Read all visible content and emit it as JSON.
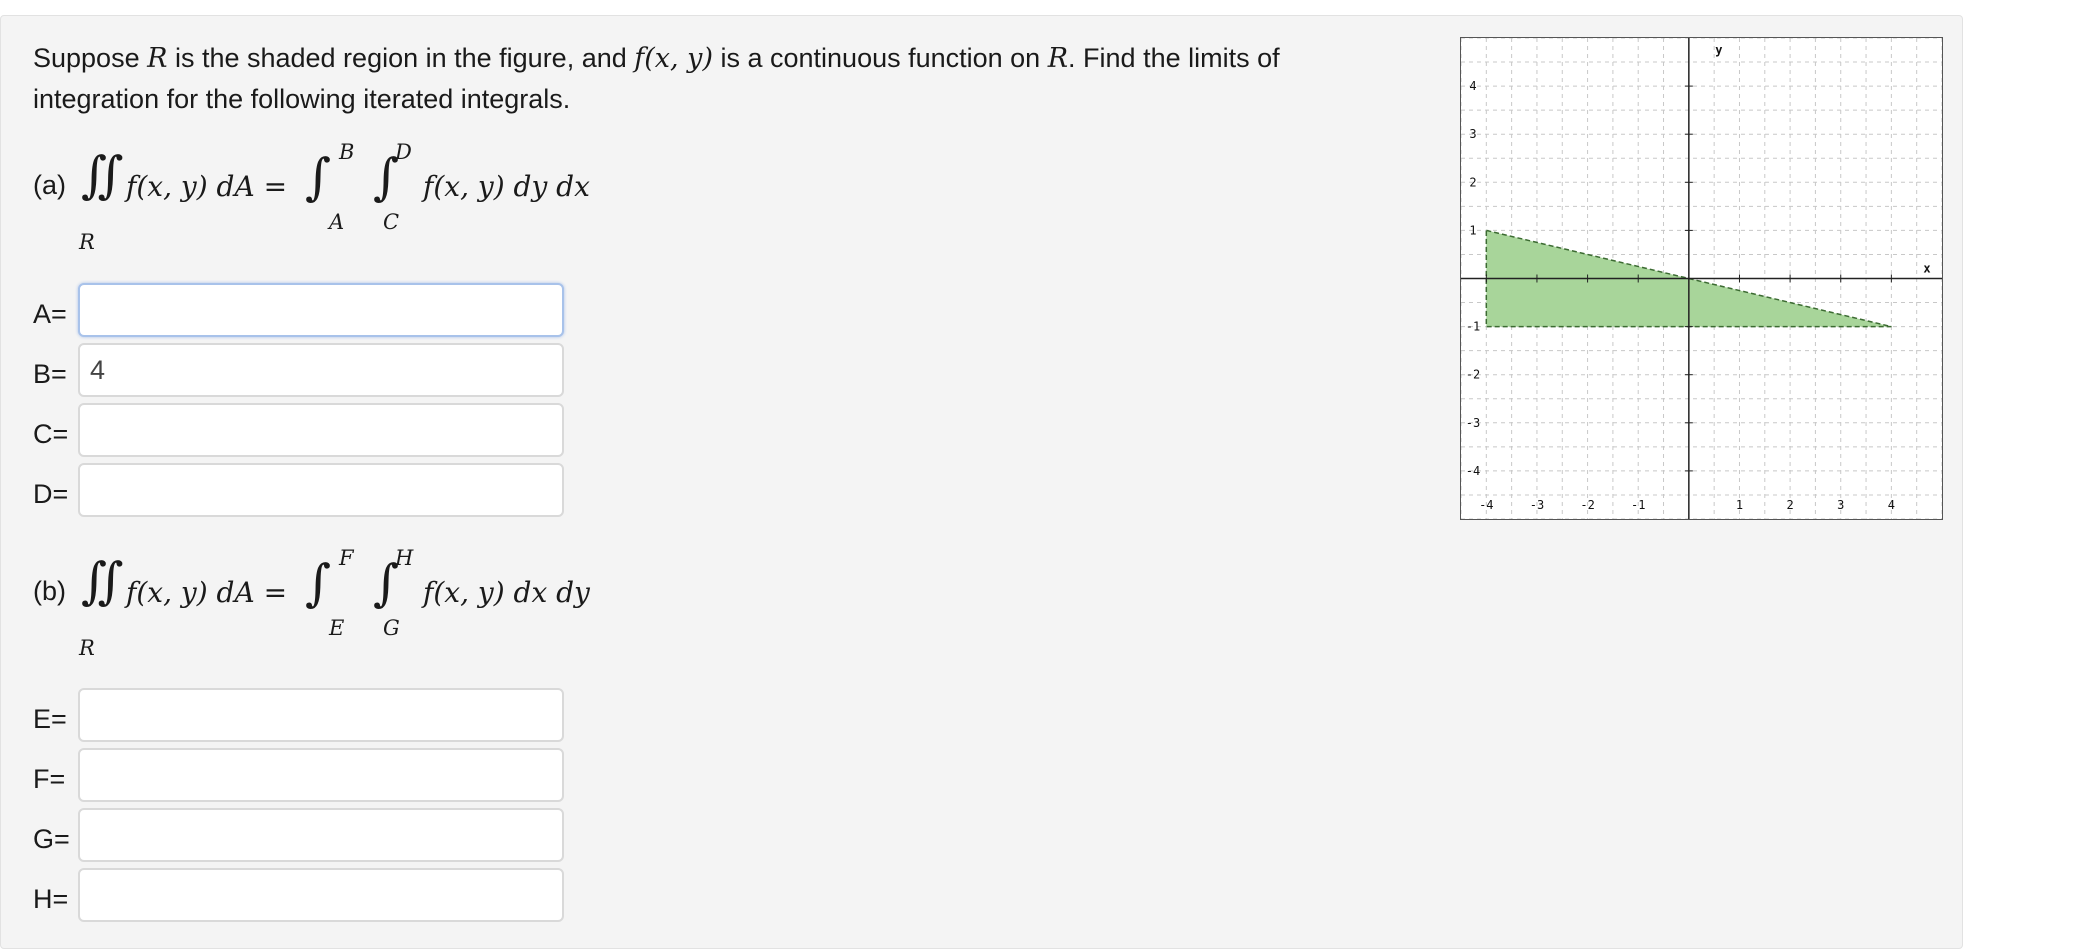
{
  "question": {
    "p1": "Suppose ",
    "R": "R",
    "p2": " is the shaded region in the figure, and ",
    "fxy": "f(x, y)",
    "p3": " is a continuous function on ",
    "R2": "R",
    "p4": ". Find the limits of integration for the following iterated integrals."
  },
  "part_a": {
    "label": "(a)",
    "lhs": "∬",
    "lhs_sub": "R",
    "lhs_expr": "f(x, y) dA =",
    "outer_upper": "B",
    "outer_lower": "A",
    "inner_upper": "D",
    "inner_lower": "C",
    "integrand": "f(x, y) dy dx",
    "int": "∫",
    "fields": [
      {
        "label": "A=",
        "value": ""
      },
      {
        "label": "B=",
        "value": "4"
      },
      {
        "label": "C=",
        "value": ""
      },
      {
        "label": "D=",
        "value": ""
      }
    ]
  },
  "part_b": {
    "label": "(b)",
    "lhs": "∬",
    "lhs_sub": "R",
    "lhs_expr": "f(x, y) dA =",
    "outer_upper": "F",
    "outer_lower": "E",
    "inner_upper": "H",
    "inner_lower": "G",
    "integrand": "f(x, y) dx dy",
    "int": "∫",
    "fields": [
      {
        "label": "E=",
        "value": ""
      },
      {
        "label": "F=",
        "value": ""
      },
      {
        "label": "G=",
        "value": ""
      },
      {
        "label": "H=",
        "value": ""
      }
    ]
  },
  "graph": {
    "x_axis_label": "x",
    "y_axis_label": "y",
    "x_ticks": [
      "-4",
      "-3",
      "-2",
      "-1",
      "1",
      "2",
      "3",
      "4"
    ],
    "y_ticks": [
      "4",
      "3",
      "2",
      "1",
      "-1",
      "-2",
      "-3",
      "-4"
    ],
    "xlim": [
      -4.5,
      5
    ],
    "ylim": [
      -5,
      5
    ],
    "region_vertices": [
      [
        -4,
        1
      ],
      [
        4,
        -1
      ],
      [
        -4,
        -1
      ]
    ],
    "fill_color": "#a8d59a",
    "edge_color": "#3c6b32"
  }
}
